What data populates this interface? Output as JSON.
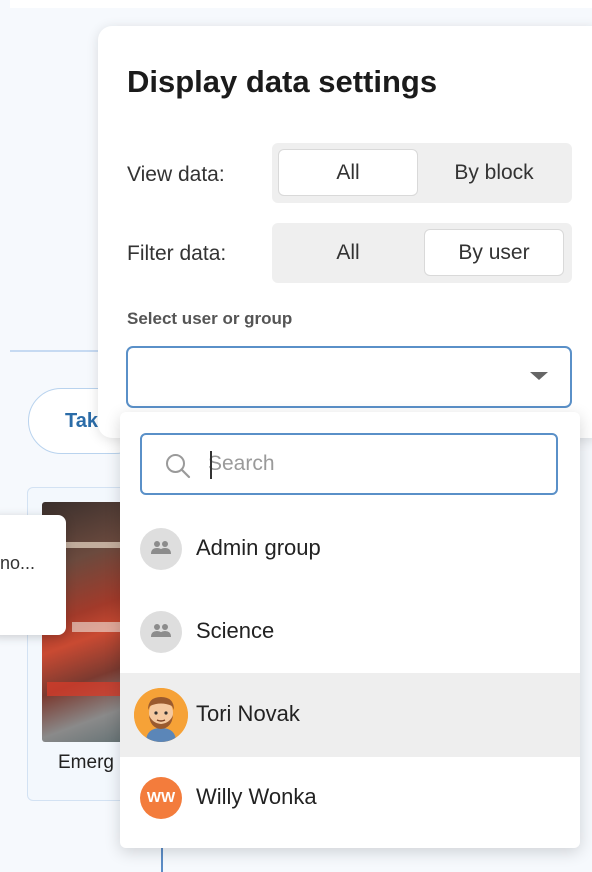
{
  "background": {
    "pill_label": "Tak",
    "card_title": "Emerg",
    "tooltip_text": "no..."
  },
  "panel": {
    "title": "Display data settings",
    "view_data": {
      "label": "View data:",
      "options": [
        "All",
        "By block"
      ],
      "selected": "All"
    },
    "filter_data": {
      "label": "Filter data:",
      "options": [
        "All",
        "By user"
      ],
      "selected": "By user"
    },
    "select_label": "Select user or group",
    "select_value": ""
  },
  "dropdown": {
    "search_placeholder": "Search",
    "search_value": "",
    "options": [
      {
        "label": "Admin group",
        "type": "group",
        "icon": "group-icon"
      },
      {
        "label": "Science",
        "type": "group",
        "icon": "group-icon"
      },
      {
        "label": "Tori Novak",
        "type": "user",
        "icon": "user-avatar",
        "highlighted": true
      },
      {
        "label": "Willy Wonka",
        "type": "user",
        "initials": "WW",
        "avatar_color": "#f37c3c"
      }
    ]
  },
  "colors": {
    "accent_border": "#5a90c8",
    "segment_bg": "#efefef",
    "highlight_row": "#eeeeee"
  }
}
